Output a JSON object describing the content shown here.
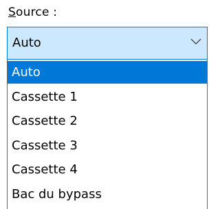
{
  "label": {
    "mnemonic": "S",
    "rest": "ource :"
  },
  "combo": {
    "value": "Auto",
    "arrow_icon": "chevron-down-icon"
  },
  "options": [
    {
      "label": "Auto",
      "selected": true
    },
    {
      "label": "Cassette 1",
      "selected": false
    },
    {
      "label": "Cassette 2",
      "selected": false
    },
    {
      "label": "Cassette 3",
      "selected": false
    },
    {
      "label": "Cassette 4",
      "selected": false
    },
    {
      "label": "Bac du bypass",
      "selected": false
    }
  ],
  "colors": {
    "accent": "#0078d7",
    "combo_bg": "#cce8ff",
    "selected_text": "#ffffff",
    "dropdown_border": "#646464"
  }
}
